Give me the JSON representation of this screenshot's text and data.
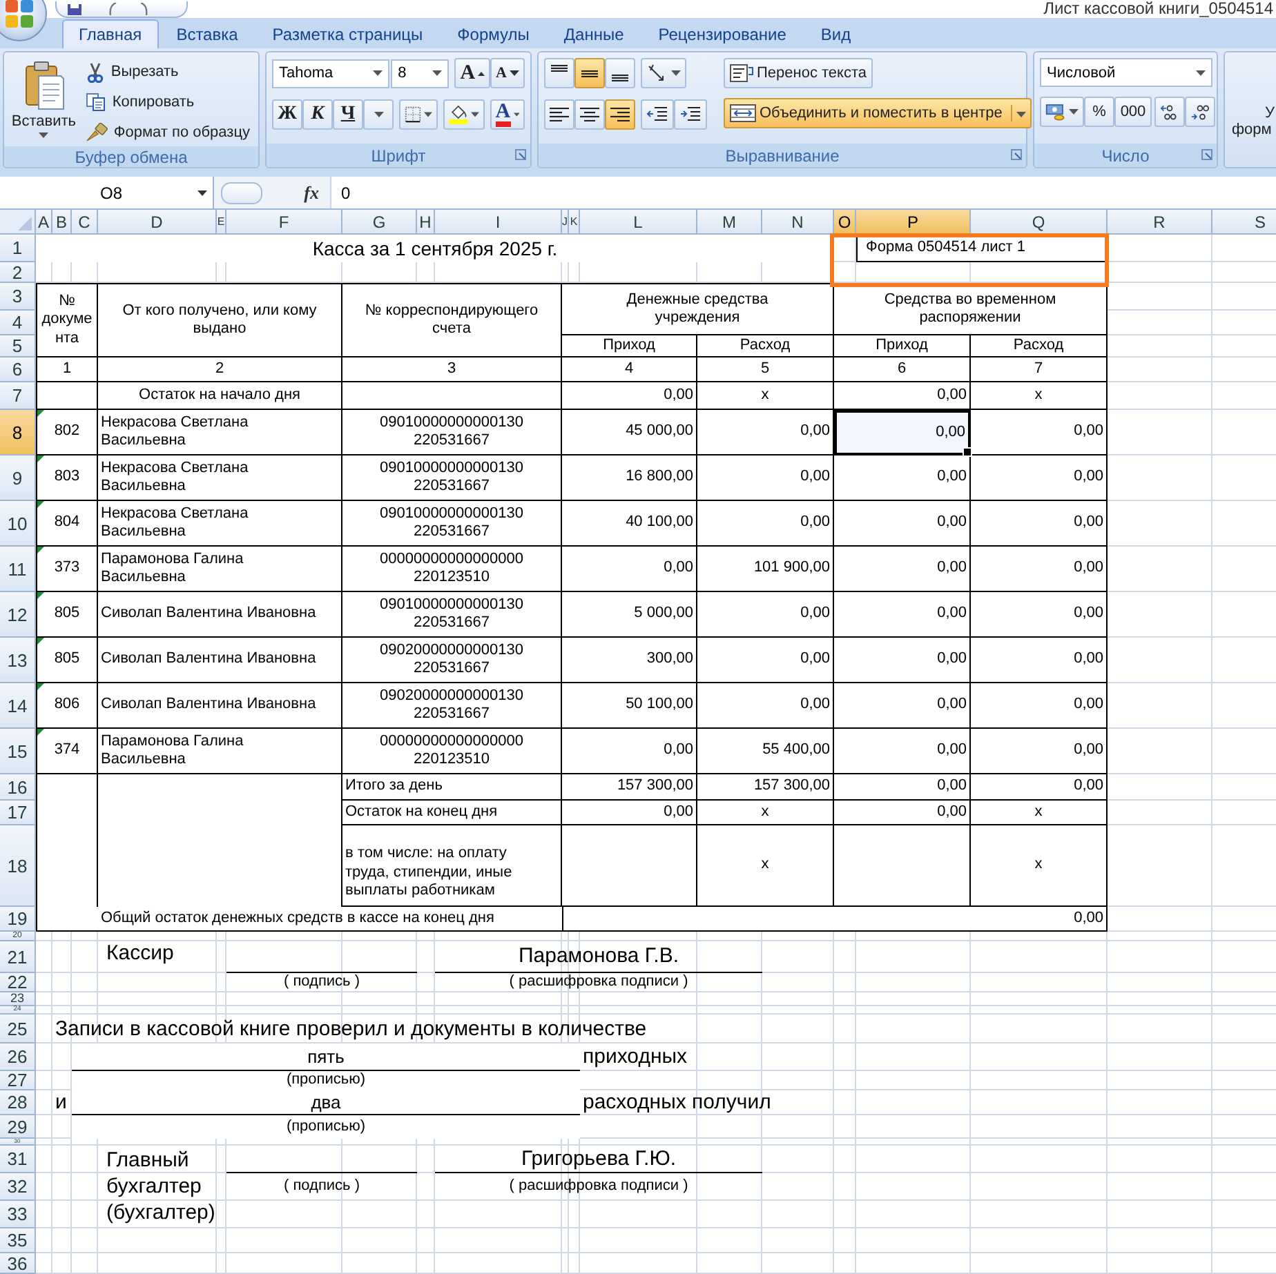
{
  "window": {
    "title": "Лист кассовой книги_0504514"
  },
  "ribbon": {
    "tabs": [
      {
        "label": "Главная",
        "selected": true
      },
      {
        "label": "Вставка",
        "selected": false
      },
      {
        "label": "Разметка страницы",
        "selected": false
      },
      {
        "label": "Формулы",
        "selected": false
      },
      {
        "label": "Данные",
        "selected": false
      },
      {
        "label": "Рецензирование",
        "selected": false
      },
      {
        "label": "Вид",
        "selected": false
      }
    ],
    "clipboard": {
      "label": "Буфер обмена",
      "paste": "Вставить",
      "actions": [
        {
          "kind": "cut",
          "label": "Вырезать"
        },
        {
          "kind": "copy",
          "label": "Копировать"
        },
        {
          "kind": "format",
          "label": "Формат по образцу"
        }
      ]
    },
    "font": {
      "label": "Шрифт",
      "font_name": "Tahoma",
      "font_size": "8",
      "grow": "A",
      "shrink": "A",
      "styles": [
        {
          "kind": "bold",
          "label": "Ж"
        },
        {
          "kind": "italic",
          "label": "К"
        },
        {
          "kind": "underline",
          "label": "Ч"
        }
      ],
      "color_letter": "A"
    },
    "alignment": {
      "label": "Выравнивание",
      "vertical": [
        {
          "kind": "top",
          "selected": false
        },
        {
          "kind": "middle",
          "selected": true
        },
        {
          "kind": "bottom",
          "selected": false
        }
      ],
      "horizontal": [
        {
          "kind": "left",
          "selected": false
        },
        {
          "kind": "center",
          "selected": false
        },
        {
          "kind": "right",
          "selected": true
        }
      ],
      "wrap_text": {
        "label": "Перенос текста",
        "selected": false
      },
      "merge": {
        "label": "Объединить и поместить в центре",
        "selected": true
      }
    },
    "number": {
      "label": "Число",
      "format": "Числовой",
      "percent": "%",
      "thousands": "000"
    },
    "cut_group": [
      "У",
      "форм"
    ]
  },
  "formula_bar": {
    "name_box": "O8",
    "fx": "fx",
    "value": "0"
  },
  "sheet": {
    "columns": [
      {
        "label": "A",
        "selected": false
      },
      {
        "label": "B",
        "selected": false
      },
      {
        "label": "C",
        "selected": false
      },
      {
        "label": "D",
        "selected": false
      },
      {
        "label": "E",
        "selected": false
      },
      {
        "label": "F",
        "selected": false
      },
      {
        "label": "G",
        "selected": false
      },
      {
        "label": "H",
        "selected": false
      },
      {
        "label": "I",
        "selected": false
      },
      {
        "label": "J",
        "selected": false
      },
      {
        "label": "K",
        "selected": false
      },
      {
        "label": "L",
        "selected": false
      },
      {
        "label": "M",
        "selected": false
      },
      {
        "label": "N",
        "selected": false
      },
      {
        "label": "O",
        "selected": true
      },
      {
        "label": "P",
        "selected": true
      },
      {
        "label": "Q",
        "selected": false
      },
      {
        "label": "R",
        "selected": false
      },
      {
        "label": "S",
        "selected": false
      }
    ],
    "rows": [
      {
        "label": "1",
        "selected": false
      },
      {
        "label": "2",
        "selected": false
      },
      {
        "label": "3",
        "selected": false
      },
      {
        "label": "4",
        "selected": false
      },
      {
        "label": "5",
        "selected": false
      },
      {
        "label": "6",
        "selected": false
      },
      {
        "label": "7",
        "selected": false
      },
      {
        "label": "8",
        "selected": true
      },
      {
        "label": "9",
        "selected": false
      },
      {
        "label": "10",
        "selected": false
      },
      {
        "label": "11",
        "selected": false
      },
      {
        "label": "12",
        "selected": false
      },
      {
        "label": "13",
        "selected": false
      },
      {
        "label": "14",
        "selected": false
      },
      {
        "label": "15",
        "selected": false
      },
      {
        "label": "16",
        "selected": false
      },
      {
        "label": "17",
        "selected": false
      },
      {
        "label": "18",
        "selected": false
      },
      {
        "label": "19",
        "selected": false
      },
      {
        "label": "20",
        "selected": false
      },
      {
        "label": "21",
        "selected": false
      },
      {
        "label": "22",
        "selected": false
      },
      {
        "label": "23",
        "selected": false
      },
      {
        "label": "24",
        "selected": false
      },
      {
        "label": "25",
        "selected": false
      },
      {
        "label": "26",
        "selected": false
      },
      {
        "label": "27",
        "selected": false
      },
      {
        "label": "28",
        "selected": false
      },
      {
        "label": "29",
        "selected": false
      },
      {
        "label": "30",
        "selected": false
      },
      {
        "label": "31",
        "selected": false
      },
      {
        "label": "32",
        "selected": false
      },
      {
        "label": "33",
        "selected": false
      },
      {
        "label": "35",
        "selected": false
      },
      {
        "label": "36",
        "selected": false
      }
    ],
    "title": "Касса за 1 сентября 2025 г.",
    "form_label": {
      "text": "Форма 0504514 лист 1",
      "highlighted": true
    },
    "headers": {
      "doc_no": "№ документа",
      "counterparty": "От кого получено, или кому выдано",
      "account": "№ корреспондирующего счета",
      "institution": "Денежные средства учреждения",
      "temporary": "Средства во временном распоряжении",
      "sub": [
        "Приход",
        "Расход",
        "Приход",
        "Расход"
      ],
      "numbers": [
        "1",
        "2",
        "3",
        "4",
        "5",
        "6",
        "7"
      ]
    },
    "opening": {
      "label": "Остаток на начало дня",
      "values": [
        "0,00",
        "х",
        "0,00",
        "х"
      ]
    },
    "entries": [
      {
        "doc_no": "802",
        "counterparty": "Некрасова Светлана Васильевна",
        "account": "09010000000000130 220531667",
        "flagged": true,
        "values": [
          {
            "text": "45 000,00",
            "selected": false
          },
          {
            "text": "0,00",
            "selected": false
          },
          {
            "text": "0,00",
            "selected": true
          },
          {
            "text": "0,00",
            "selected": false
          }
        ]
      },
      {
        "doc_no": "803",
        "counterparty": "Некрасова Светлана Васильевна",
        "account": "09010000000000130 220531667",
        "flagged": true,
        "values": [
          {
            "text": "16 800,00",
            "selected": false
          },
          {
            "text": "0,00",
            "selected": false
          },
          {
            "text": "0,00",
            "selected": false
          },
          {
            "text": "0,00",
            "selected": false
          }
        ]
      },
      {
        "doc_no": "804",
        "counterparty": "Некрасова Светлана Васильевна",
        "account": "09010000000000130 220531667",
        "flagged": true,
        "values": [
          {
            "text": "40 100,00",
            "selected": false
          },
          {
            "text": "0,00",
            "selected": false
          },
          {
            "text": "0,00",
            "selected": false
          },
          {
            "text": "0,00",
            "selected": false
          }
        ]
      },
      {
        "doc_no": "373",
        "counterparty": "Парамонова Галина Васильевна",
        "account": "00000000000000000 220123510",
        "flagged": true,
        "values": [
          {
            "text": "0,00",
            "selected": false
          },
          {
            "text": "101 900,00",
            "selected": false
          },
          {
            "text": "0,00",
            "selected": false
          },
          {
            "text": "0,00",
            "selected": false
          }
        ]
      },
      {
        "doc_no": "805",
        "counterparty": "Сиволап Валентина Ивановна",
        "account": "09010000000000130 220531667",
        "flagged": true,
        "values": [
          {
            "text": "5 000,00",
            "selected": false
          },
          {
            "text": "0,00",
            "selected": false
          },
          {
            "text": "0,00",
            "selected": false
          },
          {
            "text": "0,00",
            "selected": false
          }
        ]
      },
      {
        "doc_no": "805",
        "counterparty": "Сиволап Валентина Ивановна",
        "account": "09020000000000130 220531667",
        "flagged": true,
        "values": [
          {
            "text": "300,00",
            "selected": false
          },
          {
            "text": "0,00",
            "selected": false
          },
          {
            "text": "0,00",
            "selected": false
          },
          {
            "text": "0,00",
            "selected": false
          }
        ]
      },
      {
        "doc_no": "806",
        "counterparty": "Сиволап Валентина Ивановна",
        "account": "09020000000000130 220531667",
        "flagged": true,
        "values": [
          {
            "text": "50 100,00",
            "selected": false
          },
          {
            "text": "0,00",
            "selected": false
          },
          {
            "text": "0,00",
            "selected": false
          },
          {
            "text": "0,00",
            "selected": false
          }
        ]
      },
      {
        "doc_no": "374",
        "counterparty": "Парамонова Галина Васильевна",
        "account": "00000000000000000 220123510",
        "flagged": true,
        "values": [
          {
            "text": "0,00",
            "selected": false
          },
          {
            "text": "55 400,00",
            "selected": false
          },
          {
            "text": "0,00",
            "selected": false
          },
          {
            "text": "0,00",
            "selected": false
          }
        ]
      }
    ],
    "totals": [
      {
        "label": "Итого за день",
        "cells": {
          "institution_in": "157 300,00",
          "institution_out": "157 300,00",
          "temporary_in": "0,00",
          "temporary_out": "0,00"
        }
      },
      {
        "label": "Остаток на конец дня",
        "cells": {
          "institution_in": "0,00",
          "institution_out": "х",
          "temporary_in": "0,00",
          "temporary_out": "х"
        }
      },
      {
        "label": "в том числе: на оплату труда, стипендии, иные выплаты работникам",
        "cells": {
          "institution_out": "х",
          "temporary_out": "х"
        }
      }
    ],
    "grand_total": {
      "label": "Общий остаток денежных средств в кассе на конец дня",
      "value": "0,00"
    },
    "cashier": {
      "role": "Кассир",
      "signature_caption": "( подпись )",
      "name": "Парамонова Г.В.",
      "name_caption": "( расшифровка подписи )"
    },
    "verification": {
      "text": "Записи в кассовой книге проверил и документы в количестве",
      "incoming_count": "пять",
      "incoming_caption": "(прописью)",
      "incoming_label": "приходных",
      "conjunction": "и",
      "outgoing_count": "два",
      "outgoing_caption": "(прописью)",
      "outgoing_label": "расходных получил"
    },
    "accountant": {
      "role": "Главный бухгалтер (бухгалтер)",
      "signature_caption": "( подпись )",
      "name": "Григорьева Г.Ю.",
      "name_caption": "( расшифровка подписи )"
    }
  }
}
